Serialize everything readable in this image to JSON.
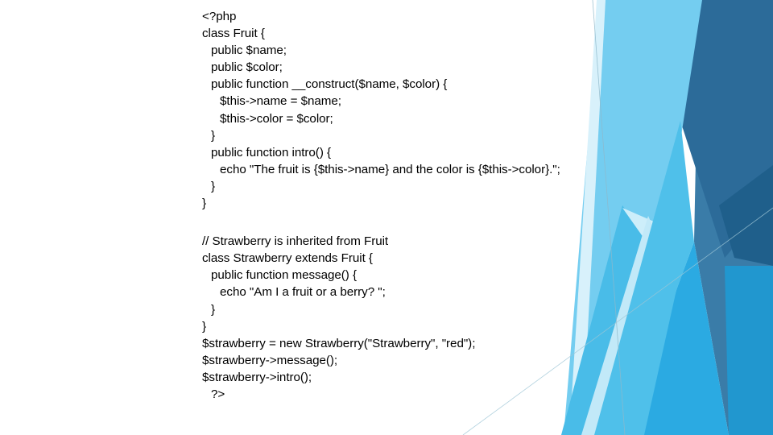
{
  "slide": {
    "title": "PHP Inheritance Code Slide",
    "background": {
      "style_name": "angled-blue-bands",
      "base_color": "#ffffff",
      "colors": {
        "pale_blue": "#cdeefa",
        "light_blue": "#74cdf0",
        "sky_blue": "#49bce8",
        "mid_blue": "#2baae2",
        "steel_blue": "#3a7ca8",
        "deep_blue": "#2c6b99",
        "navy_blue": "#1f5f8b",
        "hairline": "#9ec6d6"
      }
    },
    "text_color": "#000000"
  },
  "code": {
    "language": "php",
    "blocks": [
      {
        "name": "fruit-class-block",
        "lines": [
          {
            "text": "<?php",
            "indent": 0
          },
          {
            "text": "class Fruit {",
            "indent": 0
          },
          {
            "text": "public $name;",
            "indent": 1
          },
          {
            "text": "public $color;",
            "indent": 1
          },
          {
            "text": "public function __construct($name, $color) {",
            "indent": 1
          },
          {
            "text": "$this->name = $name;",
            "indent": 2
          },
          {
            "text": "$this->color = $color;",
            "indent": 2
          },
          {
            "text": "}",
            "indent": 1
          },
          {
            "text": "public function intro() {",
            "indent": 1
          },
          {
            "text": "echo \"The fruit is {$this->name} and the color is {$this->color}.\";",
            "indent": 2
          },
          {
            "text": "}",
            "indent": 1
          },
          {
            "text": "}",
            "indent": 0
          }
        ]
      },
      {
        "name": "strawberry-class-block",
        "lines": [
          {
            "text": "// Strawberry is inherited from Fruit",
            "indent": 0
          },
          {
            "text": "class Strawberry extends Fruit {",
            "indent": 0
          },
          {
            "text": "public function message() {",
            "indent": 1
          },
          {
            "text": "echo \"Am I a fruit or a berry? \";",
            "indent": 2
          },
          {
            "text": "}",
            "indent": 1
          },
          {
            "text": "}",
            "indent": 0
          },
          {
            "text": "$strawberry = new Strawberry(\"Strawberry\", \"red\");",
            "indent": 0
          },
          {
            "text": "$strawberry->message();",
            "indent": 0
          },
          {
            "text": "$strawberry->intro();",
            "indent": 0
          },
          {
            "text": "?>",
            "indent": 1
          }
        ]
      }
    ]
  }
}
